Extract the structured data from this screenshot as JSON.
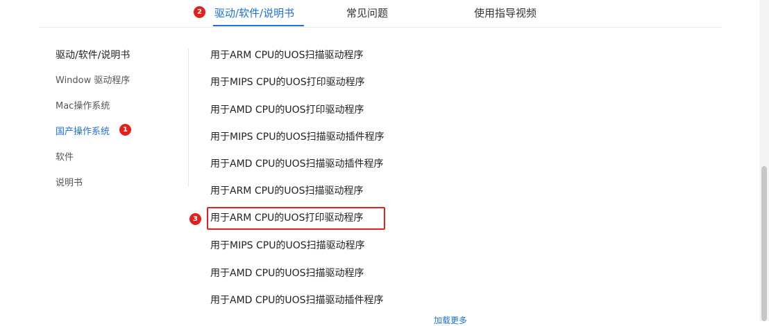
{
  "tabs": [
    {
      "label": "驱动/软件/说明书",
      "active": true
    },
    {
      "label": "常见问题",
      "active": false
    },
    {
      "label": "使用指导视频",
      "active": false
    }
  ],
  "annotations": {
    "tab_badge": "2",
    "sidebar_badge": "1",
    "list_badge": "3",
    "badge_color": "#e3201b"
  },
  "sidebar": {
    "items": [
      {
        "label": "驱动/软件/说明书"
      },
      {
        "label": "Window 驱动程序"
      },
      {
        "label": "Mac操作系统"
      },
      {
        "label": "国产操作系统",
        "active": true
      },
      {
        "label": "软件"
      },
      {
        "label": "说明书"
      }
    ]
  },
  "list": {
    "items": [
      "用于ARM CPU的UOS扫描驱动程序",
      "用于MIPS CPU的UOS打印驱动程序",
      "用于AMD CPU的UOS打印驱动程序",
      "用于MIPS CPU的UOS扫描驱动插件程序",
      "用于AMD CPU的UOS扫描驱动插件程序",
      "用于ARM CPU的UOS扫描驱动程序",
      "用于ARM CPU的UOS打印驱动程序",
      "用于MIPS CPU的UOS扫描驱动程序",
      "用于AMD CPU的UOS扫描驱动程序",
      "用于AMD CPU的UOS扫描驱动插件程序"
    ],
    "load_more": "加载更多"
  },
  "colors": {
    "accent": "#1e6fd9",
    "highlight": "#e3201b"
  }
}
